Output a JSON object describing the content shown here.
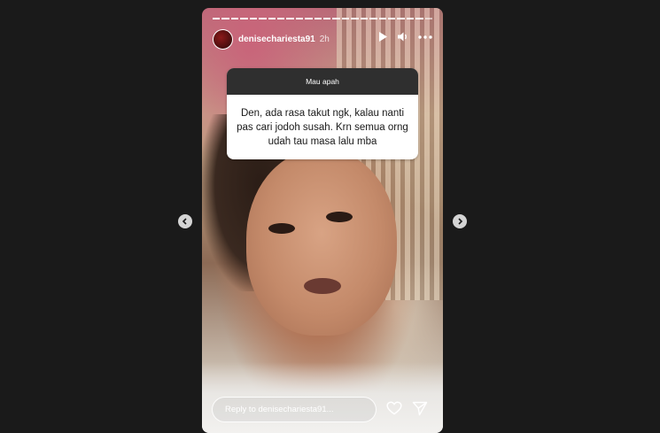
{
  "story": {
    "username": "denisechariesta91",
    "time": "2h",
    "progress_segments": 24,
    "progress_done": 23
  },
  "question": {
    "title": "Mau apah",
    "text": "Den, ada rasa takut ngk, kalau nanti pas cari jodoh susah. Krn semua orng udah tau masa lalu mba"
  },
  "reply": {
    "placeholder": "Reply to denisechariesta91..."
  },
  "icons": {
    "play": "play-icon",
    "volume": "volume-icon",
    "more": "more-icon",
    "heart": "heart-icon",
    "send": "send-icon",
    "prev": "chevron-left-icon",
    "next": "chevron-right-icon"
  }
}
